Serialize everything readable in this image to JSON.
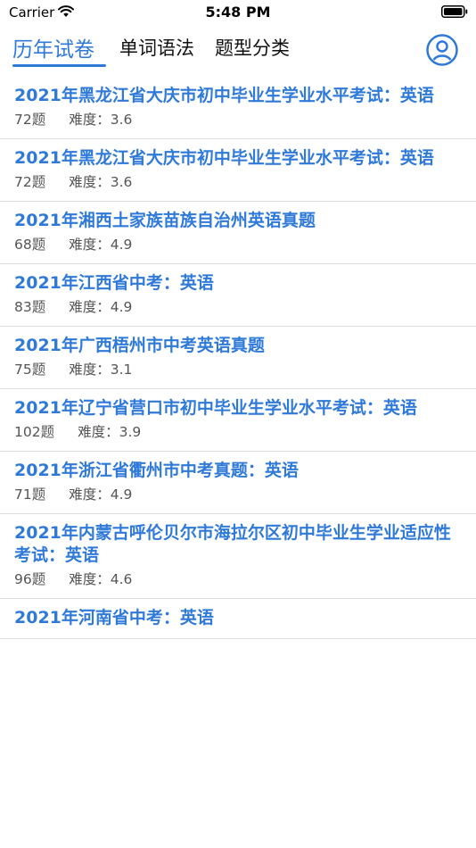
{
  "status_bar": {
    "carrier": "Carrier",
    "time": "5:48 PM"
  },
  "tabs": [
    {
      "label": "历年试卷",
      "active": true
    },
    {
      "label": "单词语法",
      "active": false
    },
    {
      "label": "题型分类",
      "active": false
    }
  ],
  "colors": {
    "accent": "#2f7ad8",
    "meta_text": "#555555",
    "divider": "#dedede"
  },
  "icons": {
    "wifi": "wifi-icon",
    "battery": "battery-icon",
    "user": "user-icon"
  },
  "papers": [
    {
      "title": "2021年黑龙江省大庆市初中毕业生学业水平考试：英语",
      "count": "72题",
      "difficulty": "难度：3.6"
    },
    {
      "title": "2021年黑龙江省大庆市初中毕业生学业水平考试：英语",
      "count": "72题",
      "difficulty": "难度：3.6"
    },
    {
      "title": "2021年湘西土家族苗族自治州英语真题",
      "count": "68题",
      "difficulty": "难度：4.9"
    },
    {
      "title": "2021年江西省中考：英语",
      "count": "83题",
      "difficulty": "难度：4.9"
    },
    {
      "title": "2021年广西梧州市中考英语真题",
      "count": "75题",
      "difficulty": "难度：3.1"
    },
    {
      "title": "2021年辽宁省营口市初中毕业生学业水平考试：英语",
      "count": "102题",
      "difficulty": "难度：3.9"
    },
    {
      "title": "2021年浙江省衢州市中考真题：英语",
      "count": "71题",
      "difficulty": "难度：4.9"
    },
    {
      "title": "2021年内蒙古呼伦贝尔市海拉尔区初中毕业生学业适应性考试：英语",
      "count": "96题",
      "difficulty": "难度：4.6"
    },
    {
      "title": "2021年河南省中考：英语",
      "count": "",
      "difficulty": ""
    }
  ]
}
